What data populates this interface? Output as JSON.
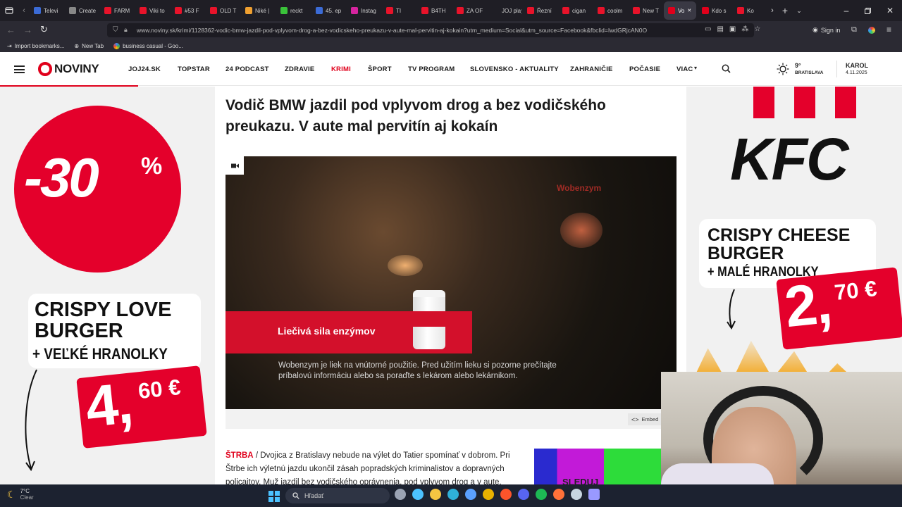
{
  "tabs": [
    {
      "label": "Televi",
      "color": "#3b6bd6"
    },
    {
      "label": "Create",
      "color": "#888888"
    },
    {
      "label": "FARM",
      "color": "#e8132a"
    },
    {
      "label": "Viki to",
      "color": "#e8132a"
    },
    {
      "label": "#53 F",
      "color": "#e8132a"
    },
    {
      "label": "OLD T",
      "color": "#e8132a"
    },
    {
      "label": "Niké |",
      "color": "#f0a030"
    },
    {
      "label": "reckt",
      "color": "#3ac23a"
    },
    {
      "label": "45. ep",
      "color": "#3b6bd6"
    },
    {
      "label": "Instag",
      "color": "#d6249f"
    },
    {
      "label": "TI",
      "color": "#e8132a"
    },
    {
      "label": "B4TH",
      "color": "#e8132a"
    },
    {
      "label": "ZA OF",
      "color": "#e8132a"
    },
    {
      "label": "JOJ play",
      "color": "#1f1e25"
    },
    {
      "label": "Řezní",
      "color": "#e8132a"
    },
    {
      "label": "cigan",
      "color": "#e8132a"
    },
    {
      "label": "coolm",
      "color": "#e8132a"
    },
    {
      "label": "New T",
      "color": "#e8132a"
    },
    {
      "label": "Vo",
      "color": "#e0001b",
      "active": true
    },
    {
      "label": "Kdo s",
      "color": "#e0001b"
    },
    {
      "label": "Ko",
      "color": "#e8132a"
    }
  ],
  "address": {
    "url": "www.noviny.sk/krimi/1128362-vodic-bmw-jazdil-pod-vplyvom-drog-a-bez-vodicskeho-preukazu-v-aute-mal-pervitin-aj-kokain?utm_medium=Social&utm_source=Facebook&fbclid=IwdGRjcAN0O",
    "signin": "Sign in"
  },
  "bookmarks": [
    "Import bookmarks...",
    "New Tab",
    "business casual - Goo..."
  ],
  "nav": {
    "logo": "NOVINY",
    "links": [
      "JOJ24.SK",
      "TOPSTAR",
      "24 PODCAST",
      "ZDRAVIE",
      "KRIMI",
      "ŠPORT",
      "TV PROGRAM",
      "SLOVENSKO - AKTUALITY",
      "ZAHRANIČIE",
      "POČASIE",
      "VIAC"
    ],
    "active_link": "KRIMI",
    "weather_temp": "9°",
    "weather_city": "BRATISLAVA",
    "nameday": "KAROL",
    "date": "4.11.2025"
  },
  "ad_left": {
    "discount": "-30",
    "percent": "%",
    "title1": "CRISPY LOVE",
    "title2": "BURGER",
    "subtitle": "+ VEĽKÉ HRANOLKY",
    "price_main": "4,",
    "price_cents": "60 €"
  },
  "ad_right": {
    "brand": "KFC",
    "title1": "CRISPY CHEESE",
    "title2": "BURGER",
    "subtitle": "+ MALÉ HRANOLKY",
    "price_main": "2,",
    "price_cents": "70 €"
  },
  "article": {
    "headline": "Vodič BMW jazdil pod vplyvom drog a bez vodičského preukazu. V aute mal pervitín aj kokaín",
    "video_brand": "Wobenzym",
    "video_caption": "Liečivá sila enzýmov",
    "video_disclaimer1": "Wobenzym je liek na vnútorné použitie. Pred užitím lieku si pozorne prečítajte",
    "video_disclaimer2": "príbalovú informáciu alebo sa poraďte s lekárom alebo lekárnikom.",
    "embed_label": "Embed",
    "location": "ŠTRBA",
    "body": "/ Dvojica z Bratislavy nebude na výlet do Tatier spomínať v dobrom. Pri Štrbe ich výletnú jazdu ukončil zásah popradských kriminalistov a dopravných policajtov. Muž jazdil bez vodičského oprávnenia, pod vplyvom drog a v aute,",
    "promo_text": "SLEDUJ"
  },
  "taskbar": {
    "weather_temp": "7°C",
    "weather_desc": "Clear",
    "search_placeholder": "Hľadať"
  },
  "colors": {
    "brand_red": "#e0001b",
    "tabbar_bg": "#1f1e25",
    "toolbar_bg": "#2b2a33",
    "taskbar_bg": "#1c2230"
  }
}
